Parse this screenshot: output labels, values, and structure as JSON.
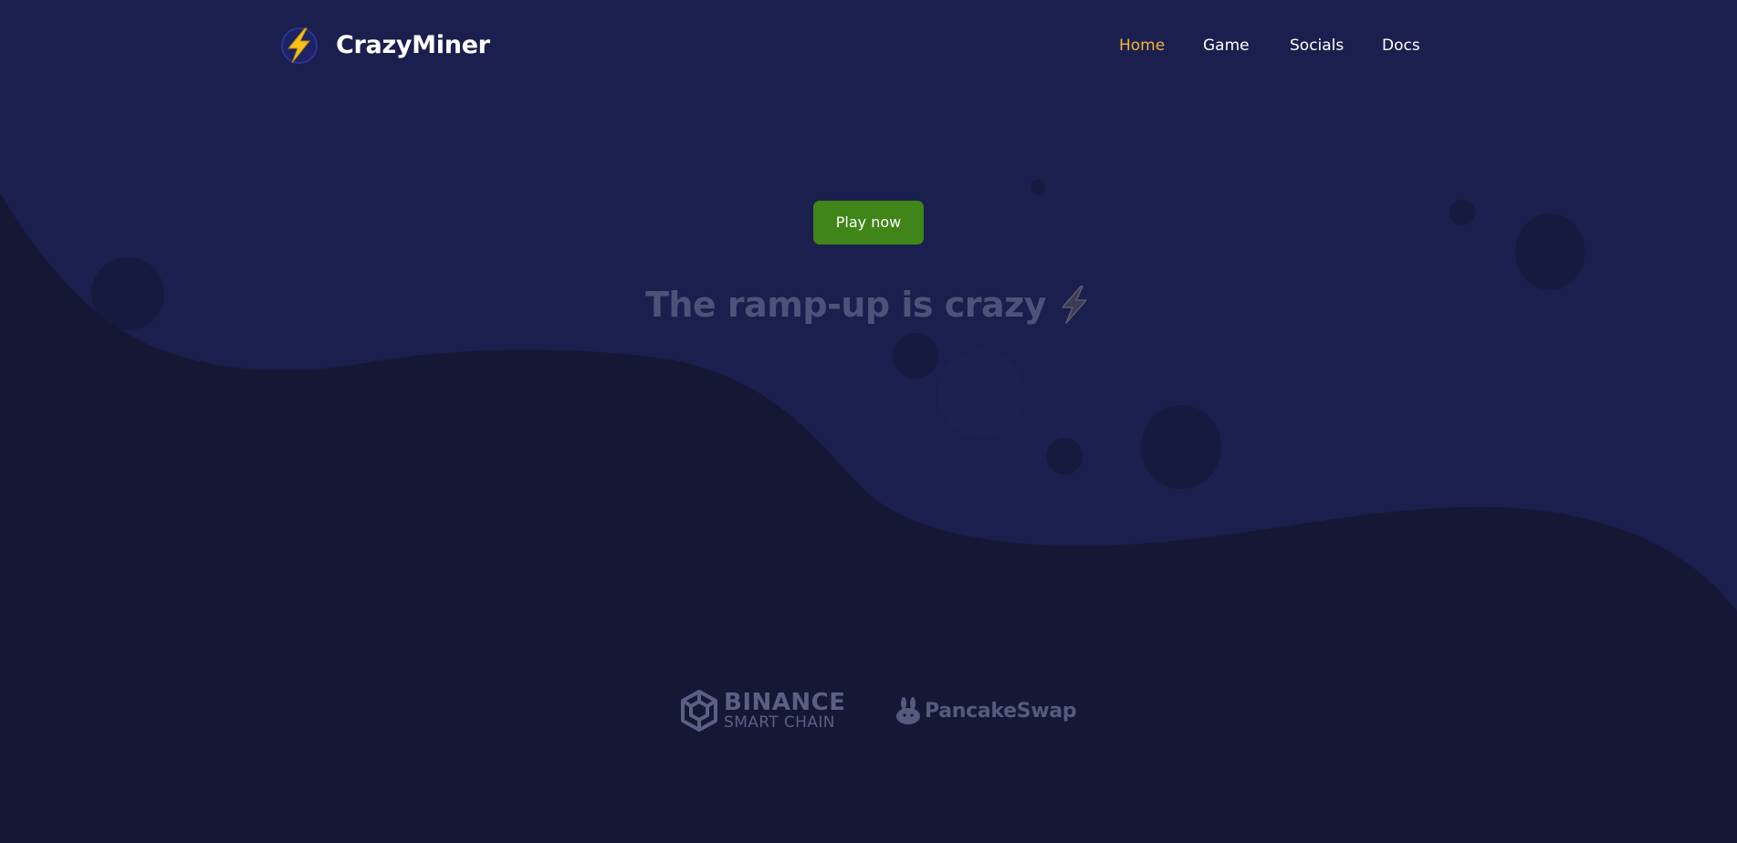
{
  "brand": {
    "name": "CrazyMiner",
    "logo_icon": "lightning-bolt-icon"
  },
  "nav": {
    "items": [
      {
        "label": "Home",
        "active": true
      },
      {
        "label": "Game",
        "active": false
      },
      {
        "label": "Socials",
        "active": false
      },
      {
        "label": "Docs",
        "active": false
      }
    ]
  },
  "hero": {
    "play_button_label": "Play now",
    "tagline": "The ramp-up is crazy",
    "tagline_icon": "lightning-bolt-icon"
  },
  "partners": {
    "binance": {
      "line1": "BINANCE",
      "line2": "SMART CHAIN",
      "icon": "binance-cube-icon"
    },
    "pancakeswap": {
      "name": "PancakeSwap",
      "icon": "bunny-icon"
    }
  },
  "colors": {
    "background_top": "#1a1f4d",
    "background_bottom": "#141835",
    "accent_active_nav": "#f5b53a",
    "play_button": "#3f8518",
    "logo_yellow": "#f7c21a"
  }
}
